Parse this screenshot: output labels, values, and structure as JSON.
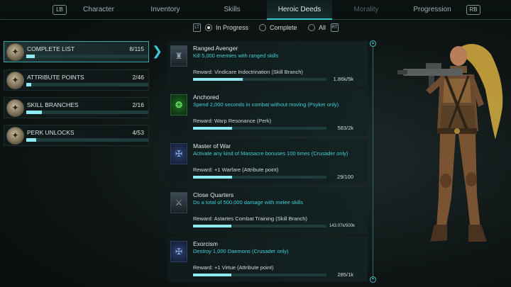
{
  "nav": {
    "left_hint": "LB",
    "right_hint": "RB",
    "tabs": [
      {
        "label": "Character"
      },
      {
        "label": "Inventory"
      },
      {
        "label": "Skills"
      },
      {
        "label": "Heroic Deeds"
      },
      {
        "label": "Morality"
      },
      {
        "label": "Progression"
      }
    ],
    "active_tab": "Heroic Deeds"
  },
  "filters": {
    "left_hint": "LT",
    "right_hint": "RT",
    "options": [
      {
        "label": "In Progress",
        "selected": true
      },
      {
        "label": "Complete",
        "selected": false
      },
      {
        "label": "All",
        "selected": false
      }
    ]
  },
  "categories": [
    {
      "label": "COMPLETE LIST",
      "count": "8/115",
      "progress": 0.07,
      "active": true
    },
    {
      "label": "ATTRIBUTE POINTS",
      "count": "2/46",
      "progress": 0.04,
      "active": false
    },
    {
      "label": "SKILL BRANCHES",
      "count": "2/16",
      "progress": 0.13,
      "active": false
    },
    {
      "label": "PERK UNLOCKS",
      "count": "4/53",
      "progress": 0.08,
      "active": false
    }
  ],
  "deeds": [
    {
      "title": "Ranged Avenger",
      "description": "Kill 5,000 enemies with ranged skills",
      "reward": "Reward: Vindicare Indoctrination (Skill Branch)",
      "value": "1.86k/5k",
      "progress": 0.372,
      "icon": "warrior-portrait-icon"
    },
    {
      "title": "Anchored",
      "description": "Spend 2,000 seconds in combat without moving (Psyker only)",
      "reward": "Reward: Warp Resonance (Perk)",
      "value": "583/2k",
      "progress": 0.29,
      "icon": "psyker-rune-icon"
    },
    {
      "title": "Master of War",
      "description": "Activate any kind of Massacre bonuses 100 times (Crusader only)",
      "reward": "Reward: +1 Warfare (Attribute point)",
      "value": "29/100",
      "progress": 0.29,
      "icon": "crusader-emblem-icon"
    },
    {
      "title": "Close Quarters",
      "description": "Do a total of 500,000 damage with melee skills",
      "reward": "Reward: Astartes Combat Training (Skill Branch)",
      "value": "143.07k/500k",
      "progress": 0.286,
      "icon": "melee-crest-icon"
    },
    {
      "title": "Exorcism",
      "description": "Destroy 1,000 Daemons (Crusader only)",
      "reward": "Reward: +1 Virtue (Attribute point)",
      "value": "285/1k",
      "progress": 0.285,
      "icon": "exorcism-emblem-icon"
    }
  ],
  "colors": {
    "accent": "#3ecfd8",
    "bar_fill": "#8fe9f0",
    "bar_track": "#1f3c3d"
  }
}
